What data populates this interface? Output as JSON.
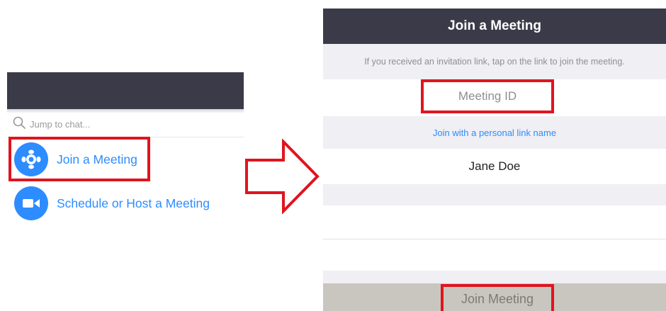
{
  "left_panel": {
    "search": {
      "placeholder": "Jump to chat..."
    },
    "items": [
      {
        "label": "Join a Meeting",
        "icon": "join-meeting-icon"
      },
      {
        "label": "Schedule or Host a Meeting",
        "icon": "video-camera-icon"
      }
    ]
  },
  "arrow": {
    "icon": "right-arrow-icon"
  },
  "right_panel": {
    "title": "Join a Meeting",
    "hint": "If you received an invitation link, tap on the link to join the meeting.",
    "meeting_id_placeholder": "Meeting ID",
    "personal_link_label": "Join with a personal link name",
    "name_value": "Jane Doe",
    "join_button_label": "Join Meeting"
  },
  "colors": {
    "header": "#3b3a48",
    "accent": "#2d8cff",
    "highlight": "#e0141e",
    "band": "#efeff4",
    "button": "#c9c6bf"
  }
}
